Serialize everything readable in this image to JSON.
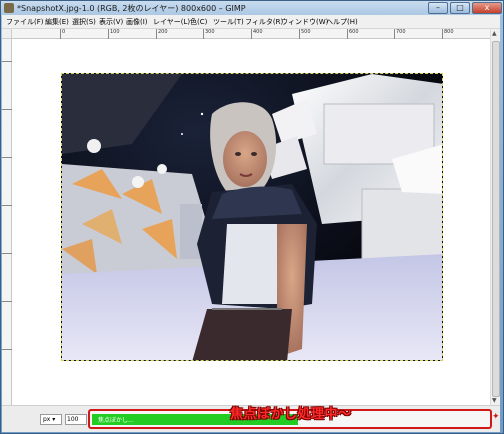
{
  "window": {
    "title": "*SnapshotX.jpg-1.0 (RGB, 2枚のレイヤー) 800x600 – GIMP",
    "min_glyph": "–",
    "max_glyph": "□",
    "close_glyph": "x"
  },
  "menubar": {
    "items": [
      "ファイル(F)",
      "編集(E)",
      "選択(S)",
      "表示(V)",
      "画像(I)",
      "レイヤー(L)",
      "色(C)",
      "ツール(T)",
      "フィルタ(R)",
      "ウィンドウ(W)",
      "ヘルプ(H)"
    ]
  },
  "ruler": {
    "labels": [
      "0",
      "100",
      "200",
      "300",
      "400",
      "500",
      "600",
      "700",
      "800"
    ]
  },
  "statusbar": {
    "unit": "px",
    "zoom": "100",
    "progress_text": "焦点ぼかし...",
    "progress_fraction": 0.52
  },
  "annotation": "焦点ぼかし処理中～",
  "colors": {
    "progress": "#22cc22",
    "annotation": "#ff2a2a",
    "title_bar": "#a8c6e3"
  }
}
